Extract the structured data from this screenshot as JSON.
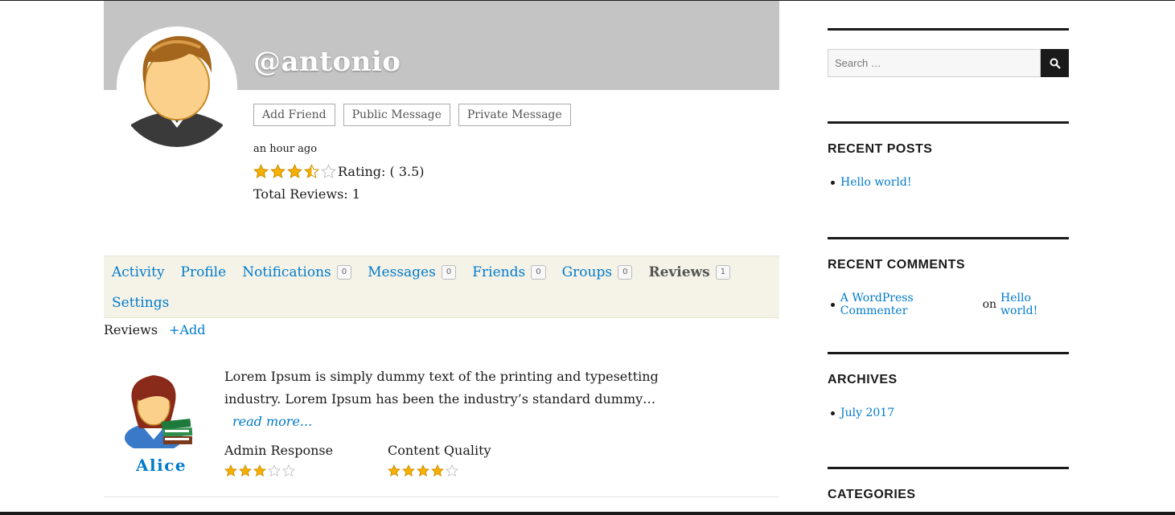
{
  "profile": {
    "handle": "@antonio",
    "buttons": {
      "add_friend": "Add Friend",
      "public_message": "Public Message",
      "private_message": "Private Message"
    },
    "last_active": "an hour ago",
    "rating_label": "Rating: ( 3.5)",
    "rating_value": 3.5,
    "total_reviews": "Total Reviews: 1"
  },
  "nav": {
    "items": [
      {
        "label": "Activity"
      },
      {
        "label": "Profile"
      },
      {
        "label": "Notifications",
        "count": "0"
      },
      {
        "label": "Messages",
        "count": "0"
      },
      {
        "label": "Friends",
        "count": "0"
      },
      {
        "label": "Groups",
        "count": "0"
      },
      {
        "label": "Reviews",
        "count": "1"
      },
      {
        "label": "Settings"
      }
    ]
  },
  "subnav": {
    "title": "Reviews",
    "add_link": "+Add"
  },
  "review": {
    "author": "Alice",
    "text": "Lorem Ipsum is simply dummy text of the printing and typesetting industry. Lorem Ipsum has been the industry’s standard dummy…",
    "read_more": "read more...",
    "criteria": [
      {
        "label": "Admin Response",
        "stars": 3
      },
      {
        "label": "Content Quality",
        "stars": 4
      }
    ]
  },
  "sidebar": {
    "search_placeholder": "Search …",
    "recent_posts": {
      "title": "RECENT POSTS",
      "items": [
        "Hello world!"
      ]
    },
    "recent_comments": {
      "title": "RECENT COMMENTS",
      "author": "A WordPress Commenter",
      "on": "on",
      "post": "Hello world!"
    },
    "archives": {
      "title": "ARCHIVES",
      "items": [
        "July 2017"
      ]
    },
    "categories": {
      "title": "CATEGORIES"
    }
  },
  "colors": {
    "link": "#007acc",
    "cover": "#c4c4c4",
    "nav_bg": "#f5f3e7",
    "star": "#f5b000"
  }
}
